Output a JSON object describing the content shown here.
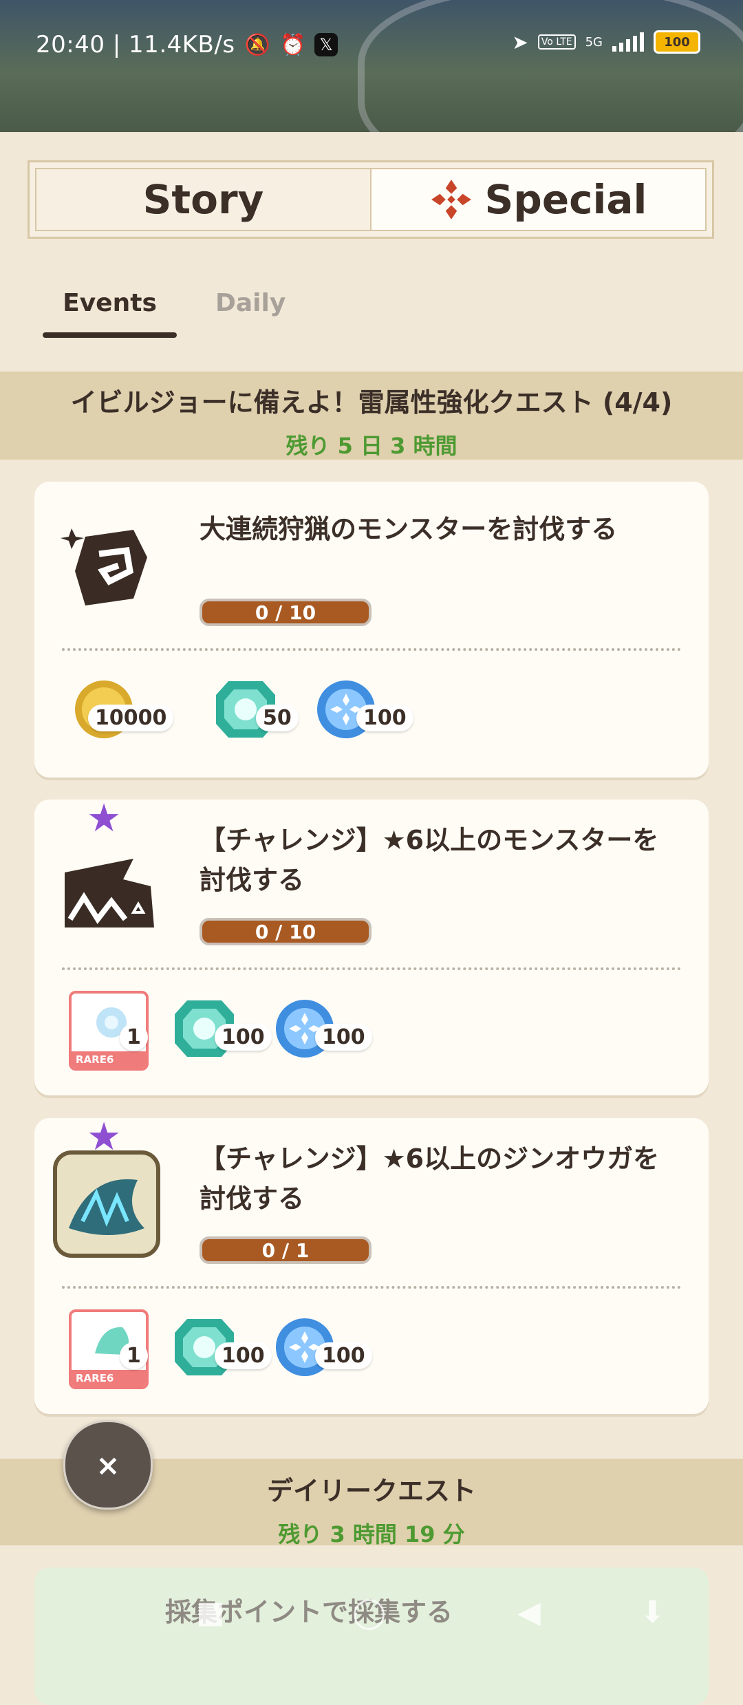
{
  "status_bar": {
    "time_speed": "20:40 | 11.4KB/s",
    "network": "5G",
    "volte": "Vo LTE",
    "battery": "100"
  },
  "segment": {
    "story_label": "Story",
    "special_label": "Special"
  },
  "tabs": {
    "events_label": "Events",
    "daily_label": "Daily"
  },
  "event_section": {
    "title": "イビルジョーに備えよ！雷属性強化クエスト (4/4)",
    "remaining": "残り 5 日 3 時間"
  },
  "quests": [
    {
      "title": "大連続狩猟のモンスターを討伐する",
      "progress": "0 / 10",
      "progress_fraction": 0,
      "rewards": [
        {
          "icon": "gold-coin-icon",
          "count": "10000"
        },
        {
          "icon": "green-gem-icon",
          "count": "50"
        },
        {
          "icon": "blue-orb-icon",
          "count": "100"
        }
      ]
    },
    {
      "title": "【チャレンジ】★6以上のモンスターを討伐する",
      "progress": "0 / 10",
      "progress_fraction": 0,
      "rewards": [
        {
          "icon": "rare-material-icon",
          "count": "1",
          "rarity": "RARE6"
        },
        {
          "icon": "green-gem-icon",
          "count": "100"
        },
        {
          "icon": "blue-orb-icon",
          "count": "100"
        }
      ]
    },
    {
      "title": "【チャレンジ】★6以上のジンオウガを討伐する",
      "progress": "0 / 1",
      "progress_fraction": 0,
      "rewards": [
        {
          "icon": "rare-material-icon",
          "count": "1",
          "rarity": "RARE6"
        },
        {
          "icon": "green-gem-icon",
          "count": "100"
        },
        {
          "icon": "blue-orb-icon",
          "count": "100"
        }
      ]
    }
  ],
  "daily_section": {
    "title": "デイリークエスト",
    "remaining": "残り 3 時間 19 分"
  },
  "daily_quests": [
    {
      "title": "採集ポイントで採集する"
    }
  ],
  "close_button_label": "×",
  "colors": {
    "band": "#dfd0ae",
    "remaining_green": "#4e9a32",
    "progress_fill": "#a85a22",
    "star": "#8e4fd0",
    "rare_border": "#f07b7b"
  }
}
